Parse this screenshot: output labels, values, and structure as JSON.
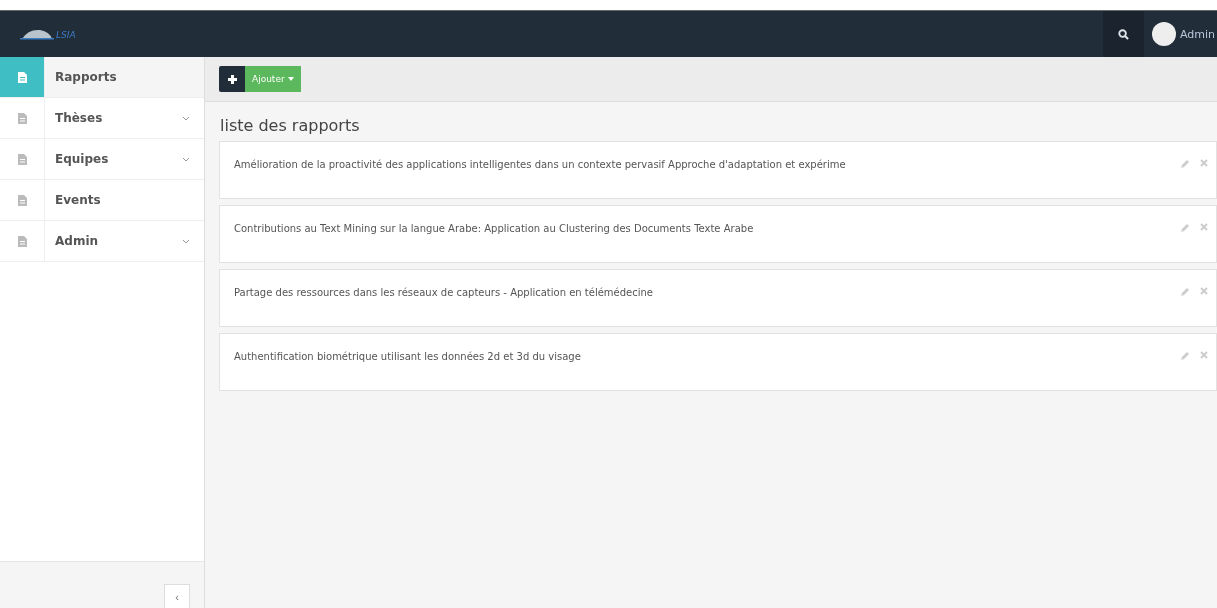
{
  "header": {
    "logo_text": "LSIA",
    "user": "Admin"
  },
  "sidebar": {
    "items": [
      {
        "label": "Rapports",
        "selected": true,
        "expandable": false
      },
      {
        "label": "Thèses",
        "selected": false,
        "expandable": true
      },
      {
        "label": "Equipes",
        "selected": false,
        "expandable": true
      },
      {
        "label": "Events",
        "selected": false,
        "expandable": false
      },
      {
        "label": "Admin",
        "selected": false,
        "expandable": true
      }
    ],
    "collapse": "‹"
  },
  "toolbar": {
    "add_button": "Ajouter"
  },
  "list": {
    "title": "liste des rapports",
    "rows": [
      {
        "title": "Amélioration de la proactivité des applications intelligentes dans un contexte pervasif Approche d'adaptation et expérime"
      },
      {
        "title": "Contributions au Text Mining sur la langue Arabe: Application au Clustering des Documents Texte Arabe"
      },
      {
        "title": "Partage des ressources dans les réseaux de capteurs - Application en télémédecine"
      },
      {
        "title": "Authentification biométrique utilisant les données 2d et 3d du visage"
      }
    ]
  }
}
